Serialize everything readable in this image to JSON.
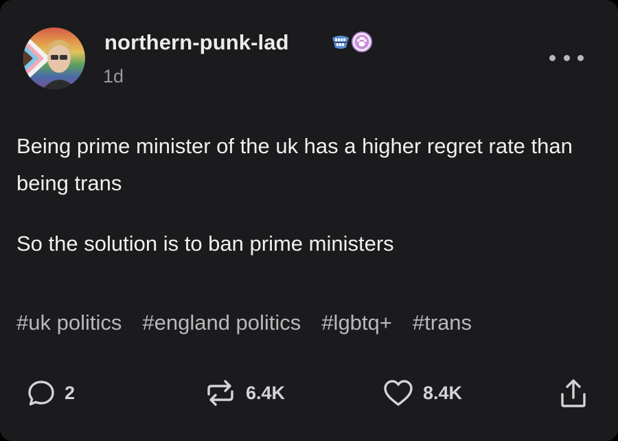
{
  "post": {
    "username": "northern-punk-lad",
    "time_ago": "1d",
    "menu_icon": "more-horizontal-icon",
    "badges": [
      "teeth-badge-icon",
      "paw-badge-icon"
    ],
    "body": [
      "Being prime minister of the uk has a higher regret rate than being trans",
      "So the solution is to ban prime ministers"
    ],
    "tags": [
      "#uk politics",
      "#england politics",
      "#lgbtq+",
      "#trans"
    ]
  },
  "actions": {
    "comments": {
      "icon": "comment-bubble-icon",
      "count": "2"
    },
    "reblogs": {
      "icon": "reblog-icon",
      "count": "6.4K"
    },
    "likes": {
      "icon": "heart-icon",
      "count": "8.4K"
    },
    "share": {
      "icon": "share-icon"
    }
  },
  "colors": {
    "card_background": "#1b1b1d",
    "text": "#f0f0f0",
    "muted_text": "#9a9a9c",
    "tag_text": "#b9b9bb"
  }
}
